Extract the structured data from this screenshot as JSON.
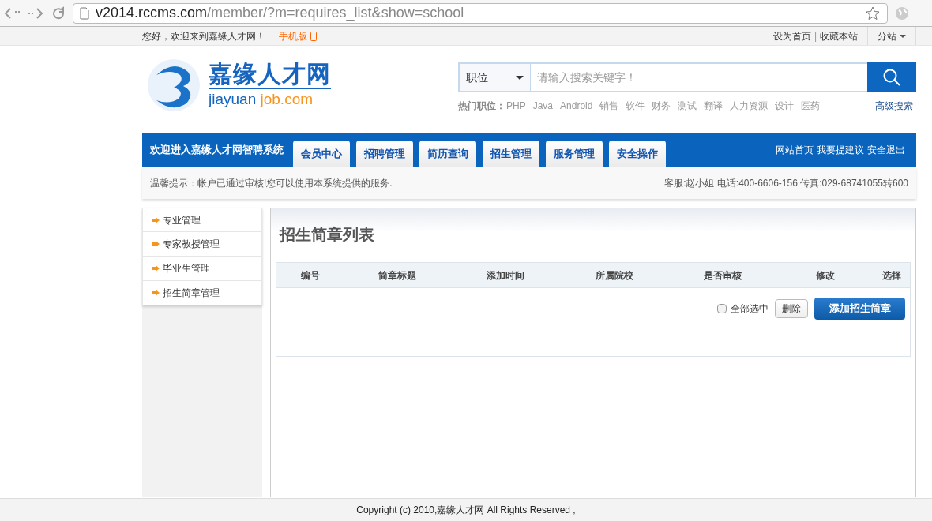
{
  "browser": {
    "url_host": "v2014.rccms.com",
    "url_path": "/member/?m=requires_list&show=school"
  },
  "top_bar": {
    "welcome": "您好，欢迎来到嘉缘人才网！",
    "mobile": "手机版",
    "links": [
      "设为首页",
      "|",
      "收藏本站"
    ],
    "branch": "分站"
  },
  "logo": {
    "name": "嘉缘人才网",
    "domain_a": "jiayuan",
    "domain_b": "job.com"
  },
  "search": {
    "category": "职位",
    "placeholder": "请输入搜索关键字！",
    "hot_label": "热门职位：",
    "hot": [
      "PHP",
      "Java",
      "Android",
      "销售",
      "软件",
      "财务",
      "测试",
      "翻译",
      "人力资源",
      "设计",
      "医药"
    ],
    "advanced": "高级搜索"
  },
  "nav": {
    "title": "欢迎进入嘉缘人才网智聘系统",
    "tabs": [
      {
        "label": "会员中心",
        "selected": false
      },
      {
        "label": "招聘管理",
        "selected": false
      },
      {
        "label": "简历查询",
        "selected": false
      },
      {
        "label": "招生管理",
        "selected": false
      },
      {
        "label": "服务管理",
        "selected": false
      },
      {
        "label": "安全操作",
        "selected": false
      }
    ],
    "links": [
      "网站首页",
      "我要提建议",
      "安全退出"
    ]
  },
  "notice": {
    "tip": "温馨提示：帐户已通过审核!您可以使用本系统提供的服务.",
    "contact": "客服:赵小姐 电话:400-6606-156 传真:029-68741055转600"
  },
  "sidebar": {
    "items": [
      "专业管理",
      "专家教授管理",
      "毕业生管理",
      "招生简章管理"
    ]
  },
  "main": {
    "title": "招生简章列表",
    "table": {
      "columns": [
        "编号",
        "简章标题",
        "添加时间",
        "所属院校",
        "是否审核",
        "修改",
        "选择"
      ]
    },
    "select_all": {
      "label": "全部选中",
      "checked": false
    },
    "delete": "删除",
    "add": "添加招生简章"
  },
  "footer": "Copyright (c) 2010,嘉缘人才网 All Rights Reserved ,"
}
